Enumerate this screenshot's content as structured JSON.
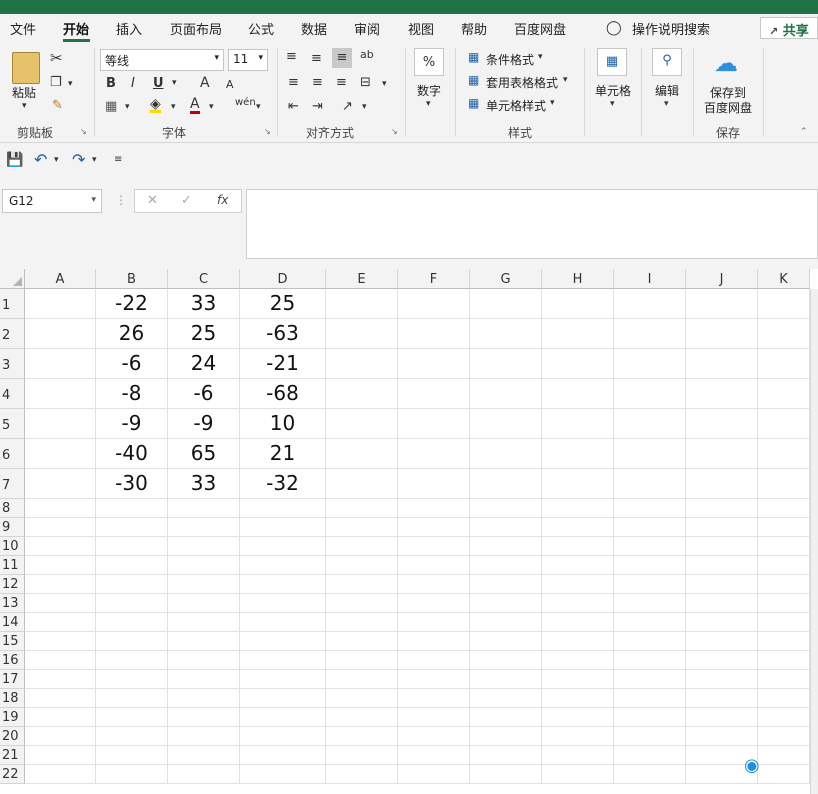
{
  "ribbon_tabs": [
    "文件",
    "开始",
    "插入",
    "页面布局",
    "公式",
    "数据",
    "审阅",
    "视图",
    "帮助",
    "百度网盘"
  ],
  "tell_me": "操作说明搜索",
  "share_label": "共享",
  "clipboard": {
    "paste": "粘贴",
    "group": "剪贴板"
  },
  "font": {
    "name": "等线",
    "size": "11",
    "group": "字体",
    "bold": "B",
    "italic": "I",
    "underline": "U",
    "grow": "A",
    "shrink": "A",
    "color_a": "A",
    "phonetic": "wén"
  },
  "alignment": {
    "group": "对齐方式"
  },
  "number": {
    "label": "数字",
    "symbol": "%"
  },
  "styles": {
    "conditional": "条件格式",
    "table": "套用表格格式",
    "cell": "单元格样式",
    "group": "样式"
  },
  "cells": {
    "label": "单元格"
  },
  "editing": {
    "label": "编辑"
  },
  "save_baidu": {
    "label1": "保存到",
    "label2": "百度网盘",
    "group": "保存"
  },
  "name_box": "G12",
  "fx": "fx",
  "columns": [
    "A",
    "B",
    "C",
    "D",
    "E",
    "F",
    "G",
    "H",
    "I",
    "J",
    "K"
  ],
  "rows": [
    "1",
    "2",
    "3",
    "4",
    "5",
    "6",
    "7",
    "8",
    "9",
    "10",
    "11",
    "12",
    "13",
    "14",
    "15",
    "16",
    "17",
    "18",
    "19",
    "20",
    "21",
    "22"
  ],
  "cells_data": [
    [
      "-22",
      "33",
      "25"
    ],
    [
      "26",
      "25",
      "-63"
    ],
    [
      "-6",
      "24",
      "-21"
    ],
    [
      "-8",
      "-6",
      "-68"
    ],
    [
      "-9",
      "-9",
      "10"
    ],
    [
      "-40",
      "65",
      "21"
    ],
    [
      "-30",
      "33",
      "-32"
    ]
  ]
}
